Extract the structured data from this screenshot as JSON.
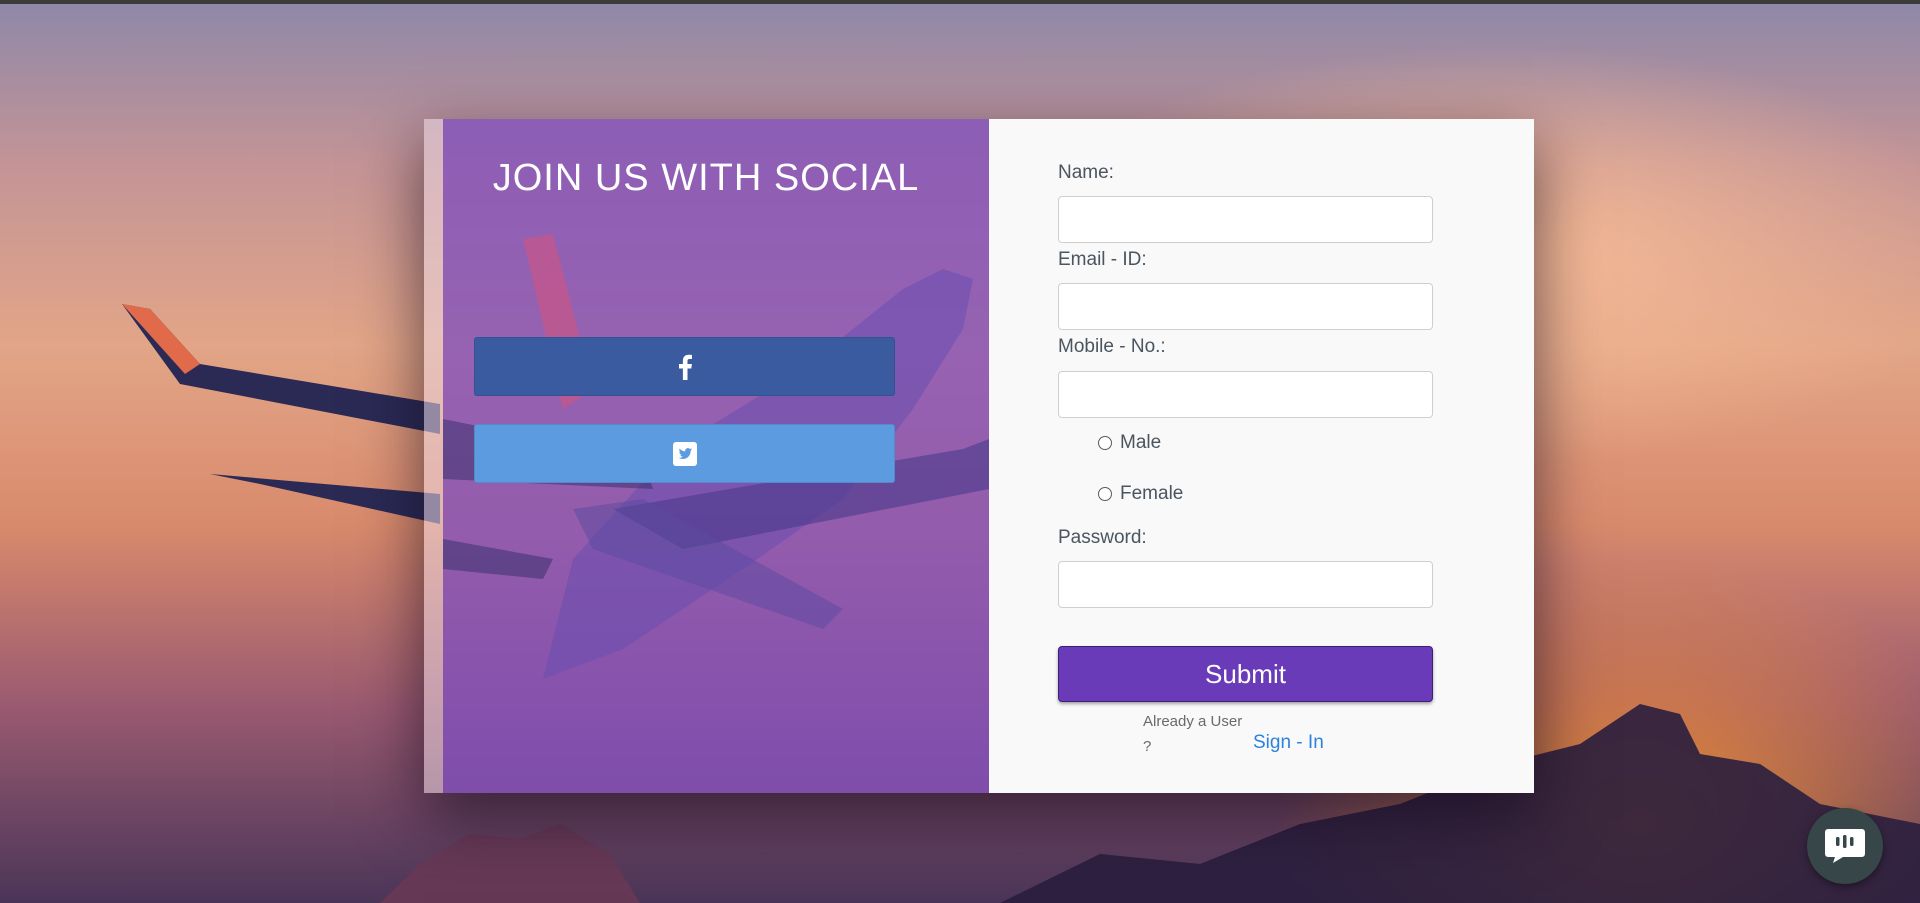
{
  "left": {
    "title": "JOIN US WITH SOCIAL",
    "facebook_icon": "facebook-f-icon",
    "twitter_icon": "twitter-square-icon"
  },
  "form": {
    "name_label": "Name:",
    "name_value": "",
    "email_label": "Email - ID:",
    "email_value": "",
    "mobile_label": "Mobile - No.:",
    "mobile_value": "",
    "gender_options": [
      "Male",
      "Female"
    ],
    "password_label": "Password:",
    "password_value": "",
    "submit_label": "Submit",
    "already_user_text": "Already a User ?",
    "signin_label": "Sign - In"
  },
  "chat": {
    "icon": "chat-bubble-icon"
  },
  "colors": {
    "social_panel": "#8050be",
    "facebook": "#3b5ba1",
    "twitter": "#5c9be0",
    "submit": "#6a3bb8",
    "link": "#2c82e0"
  }
}
